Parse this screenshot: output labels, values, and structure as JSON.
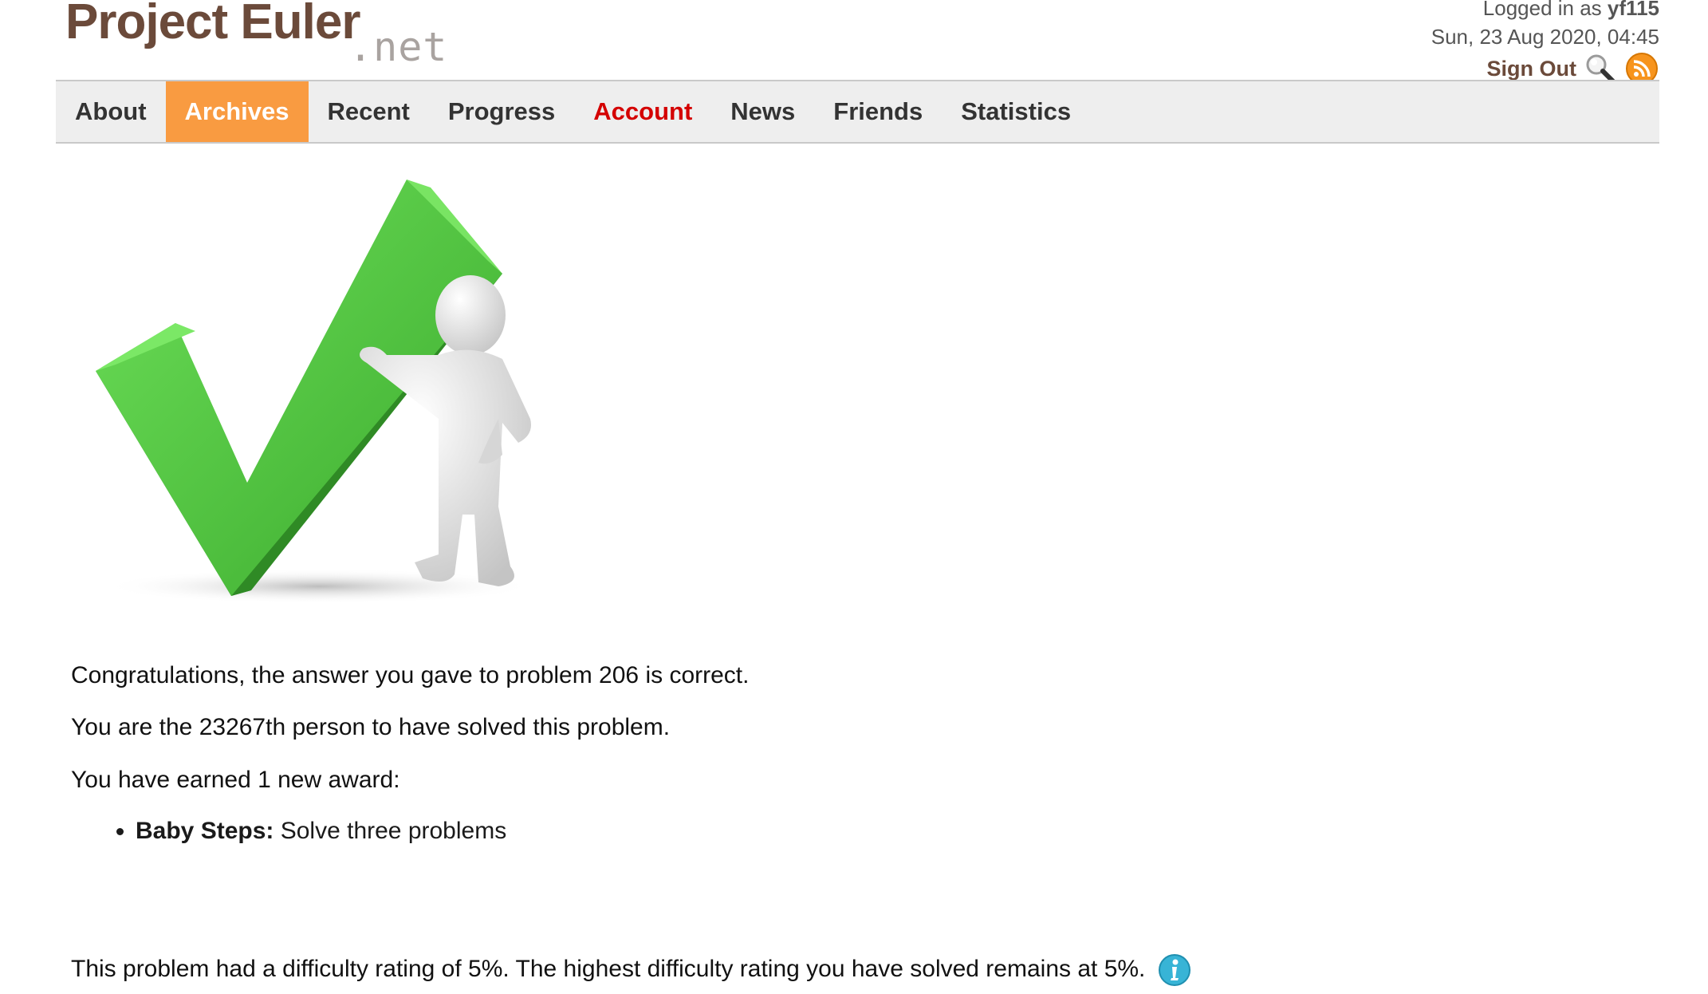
{
  "header": {
    "logo_main": "Project Euler",
    "logo_tld": ".net",
    "logged_in_prefix": "Logged in as",
    "username": "yf115",
    "datetime": "Sun, 23 Aug 2020, 04:45",
    "sign_out": "Sign Out",
    "search_icon": "search-icon",
    "rss_icon": "rss-icon"
  },
  "nav": {
    "items": [
      {
        "label": "About"
      },
      {
        "label": "Archives",
        "state": "active"
      },
      {
        "label": "Recent"
      },
      {
        "label": "Progress"
      },
      {
        "label": "Account",
        "state": "alert"
      },
      {
        "label": "News"
      },
      {
        "label": "Friends"
      },
      {
        "label": "Statistics"
      }
    ],
    "active_color": "#f99b41",
    "alert_color": "#d40000"
  },
  "main": {
    "image": "checkmark-with-figure",
    "congrats": "Congratulations, the answer you gave to problem 206 is correct.",
    "solver_rank": "You are the 23267th person to have solved this problem.",
    "awards_intro": "You have earned 1 new award:",
    "awards": [
      {
        "name": "Baby Steps:",
        "description": "Solve three problems"
      }
    ],
    "difficulty": "This problem had a difficulty rating of 5%. The highest difficulty rating you have solved remains at 5%.",
    "info_icon": "info-icon"
  }
}
